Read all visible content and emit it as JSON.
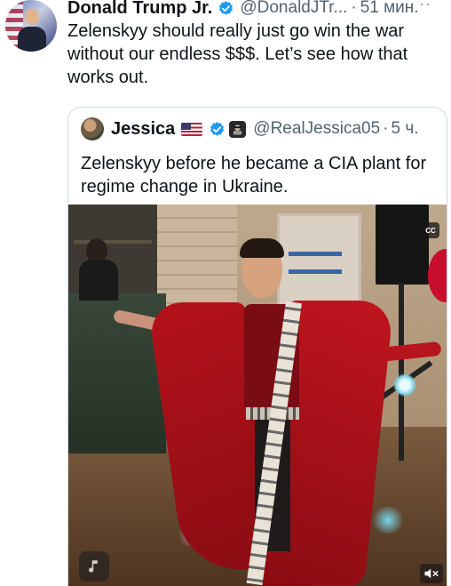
{
  "tweet": {
    "author_name": "Donald Trump Jr.",
    "handle": "@DonaldJTr...",
    "separator": "·",
    "time": "51 мин.",
    "more": "··",
    "text": "Zelenskyy should really just go win the war without our endless $$$. Let’s see how that works out."
  },
  "quote": {
    "author_name": "Jessica",
    "handle": "@RealJessica05",
    "separator": "·",
    "time": "5 ч.",
    "text": "Zelenskyy before he became a CIA plant for regime change in Ukraine."
  },
  "video": {
    "cc_label": "CC"
  },
  "colors": {
    "verified_blue": "#1d9bf0",
    "secondary_text": "#536471",
    "border": "#cfd9de"
  }
}
